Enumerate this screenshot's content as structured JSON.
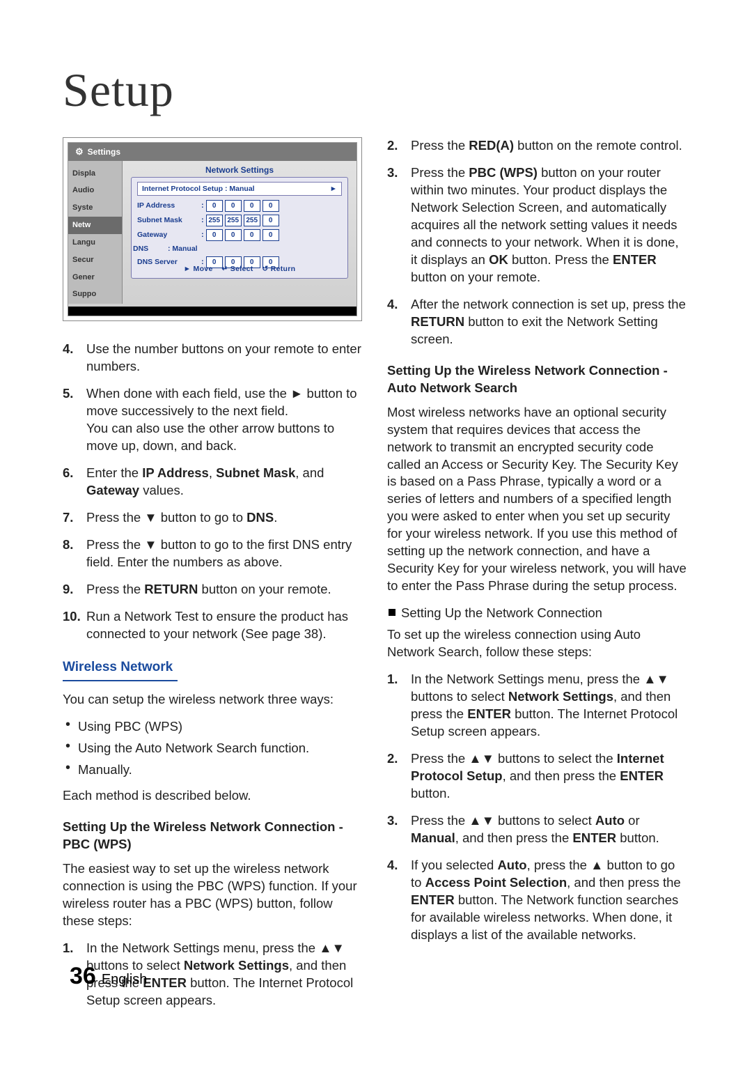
{
  "title": "Setup",
  "tv": {
    "settings": "Settings",
    "side": [
      "Displa",
      "Audio",
      "Syste",
      "Netw",
      "Langu",
      "Secur",
      "Gener",
      "Suppo"
    ],
    "main_title": "Network Settings",
    "protocol_line": "Internet Protocol Setup : Manual",
    "arrow": "►",
    "rows": {
      "ip": {
        "label": "IP Address",
        "v": [
          "0",
          "0",
          "0",
          "0"
        ]
      },
      "sm": {
        "label": "Subnet Mask",
        "v": [
          "255",
          "255",
          "255",
          "0"
        ]
      },
      "gw": {
        "label": "Gateway",
        "v": [
          "0",
          "0",
          "0",
          "0"
        ]
      },
      "dns_label": "DNS",
      "dns_mode": ": Manual",
      "dns": {
        "label": "DNS Server",
        "v": [
          "0",
          "0",
          "0",
          "0"
        ]
      }
    },
    "foot_move": "► Move",
    "foot_select": "↵ Select",
    "foot_return": "↺ Return"
  },
  "left_list_a": [
    {
      "n": "4.",
      "t": "Use the number buttons on your remote to enter numbers."
    },
    {
      "n": "5.",
      "t_parts": [
        "When done with each field, use the ► button to move successively to the next field.",
        "You can also use the other arrow buttons to move up, down, and back."
      ]
    },
    {
      "n": "6.",
      "html": "Enter the <b>IP Address</b>, <b>Subnet Mask</b>, and <b>Gateway</b> values."
    },
    {
      "n": "7.",
      "html": "Press the ▼ button to go to <b>DNS</b>."
    },
    {
      "n": "8.",
      "t": "Press the ▼ button to go to the first DNS entry field. Enter the numbers as above."
    },
    {
      "n": "9.",
      "html": "Press the <b>RETURN</b> button on your remote."
    },
    {
      "n": "10.",
      "t": "Run a Network Test to ensure the product has connected to your network (See page 38)."
    }
  ],
  "wireless_heading": "Wireless Network",
  "wireless_intro": "You can setup the wireless network three ways:",
  "wireless_bullets": [
    "Using PBC (WPS)",
    "Using the Auto Network Search function.",
    "Manually."
  ],
  "wireless_after": "Each method is described below.",
  "pbc_heading": "Setting Up the Wireless Network Connection - PBC (WPS)",
  "pbc_intro": "The easiest way to set up the wireless network connection is using the PBC (WPS) function. If your wireless router has a PBC (WPS) button, follow these steps:",
  "pbc_step1": "In the Network Settings menu, press the ▲▼ buttons to select <b>Network Settings</b>, and then press the <b>ENTER</b> button. The Internet Protocol Setup screen appears.",
  "right_list_a": [
    {
      "n": "2.",
      "html": "Press the <b>RED(A)</b> button on the remote control."
    },
    {
      "n": "3.",
      "html": "Press the <b>PBC (WPS)</b> button on your router within two minutes. Your product displays the Network Selection Screen, and automatically acquires all the network setting values it needs and connects to your network. When it is done, it displays an <b>OK</b> button. Press the <b>ENTER</b> button on your remote."
    },
    {
      "n": "4.",
      "html": "After the network connection is set up, press the <b>RETURN</b> button to exit the Network Setting screen."
    }
  ],
  "auto_heading": "Setting Up the Wireless Network Connection - Auto Network Search",
  "auto_para": "Most wireless networks have an optional security system that requires devices that access the network to transmit an encrypted security code called an Access or Security Key. The Security Key is based on a Pass Phrase, typically a word or a series of letters and numbers of a specified length you were asked to enter when you set up security for your wireless network. If you use this method of setting up the network connection, and have a Security Key for your wireless network, you will have to enter the Pass Phrase during the setup process.",
  "auto_sub": "Setting Up the Network Connection",
  "auto_sub_intro": "To set up the wireless connection using Auto Network Search, follow these steps:",
  "auto_steps": [
    {
      "n": "1.",
      "html": "In the Network Settings menu, press the ▲▼ buttons to select <b>Network Settings</b>, and then press the <b>ENTER</b> button. The Internet Protocol Setup screen appears."
    },
    {
      "n": "2.",
      "html": "Press the ▲▼ buttons to select the <b>Internet Protocol Setup</b>, and then press the <b>ENTER</b> button."
    },
    {
      "n": "3.",
      "html": "Press the ▲▼ buttons to select <b>Auto</b> or <b>Manual</b>, and then press the <b>ENTER</b> button."
    },
    {
      "n": "4.",
      "html": "If you selected <b>Auto</b>, press the ▲ button to go to <b>Access Point Selection</b>, and then press the <b>ENTER</b> button. The Network function searches for available wireless networks. When done, it displays a list of the available networks."
    }
  ],
  "footer_page": "36",
  "footer_lang": "English"
}
